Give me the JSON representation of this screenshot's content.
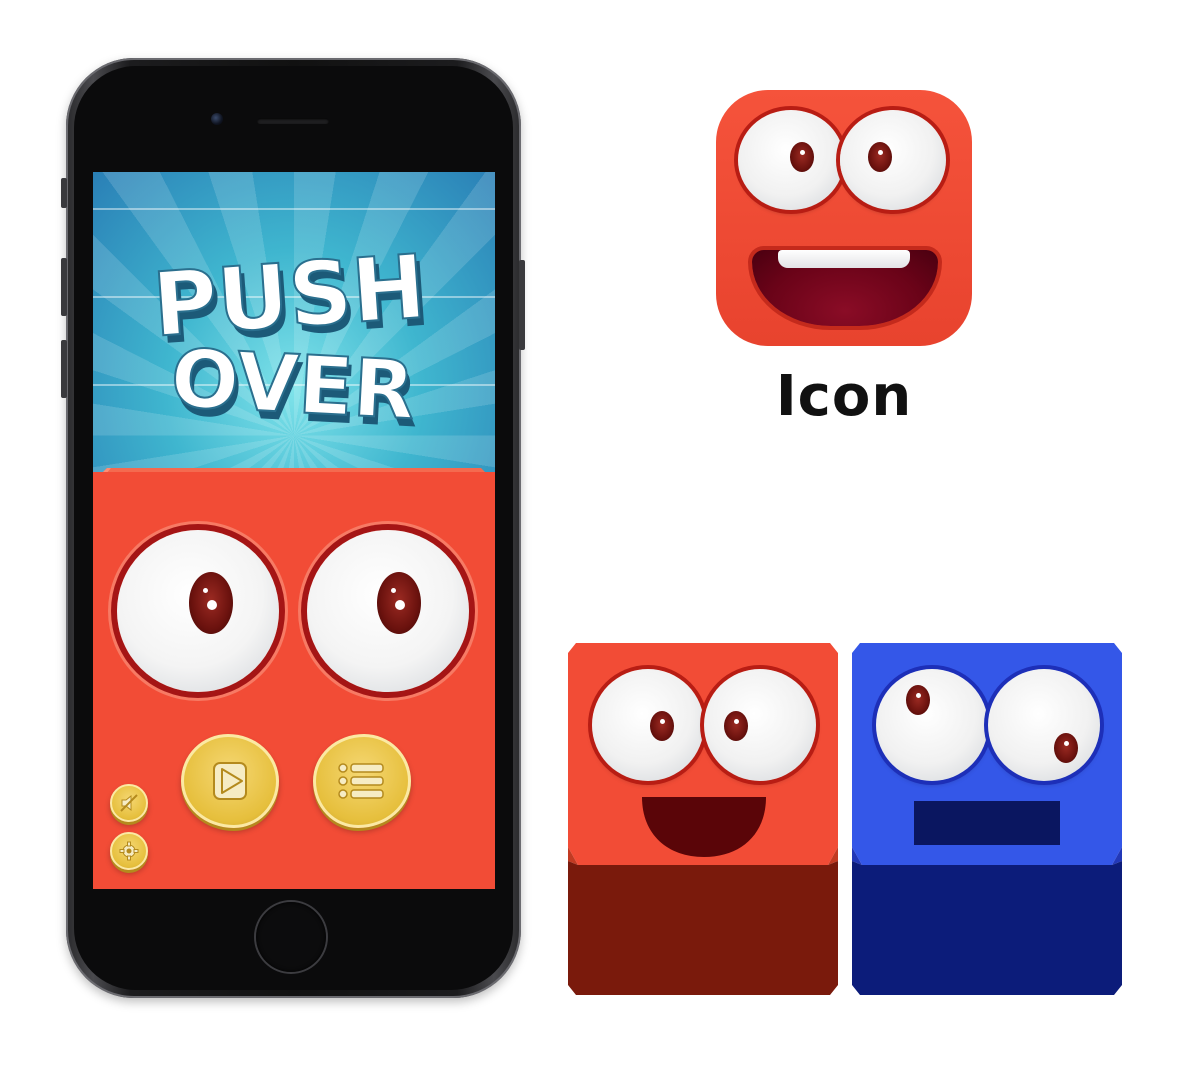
{
  "game": {
    "title_line1": "PUSH",
    "title_line2": "OVER",
    "play_button_label": "Play",
    "menu_button_label": "Menu",
    "sound_button_label": "Sound off",
    "settings_button_label": "Settings"
  },
  "icon_section": {
    "label": "Icon"
  },
  "characters": [
    {
      "name": "red-block",
      "color": "#f24c36"
    },
    {
      "name": "blue-block",
      "color": "#3457e8"
    }
  ],
  "colors": {
    "red": "#f24c36",
    "red_dark": "#7a1a0c",
    "blue": "#3457e8",
    "blue_dark": "#0c1c7a",
    "sky": "#3fb6cf",
    "button_gold": "#e6bf3c"
  },
  "icons": [
    "camera-icon",
    "play-icon",
    "list-icon",
    "sound-off-icon",
    "gear-icon"
  ]
}
